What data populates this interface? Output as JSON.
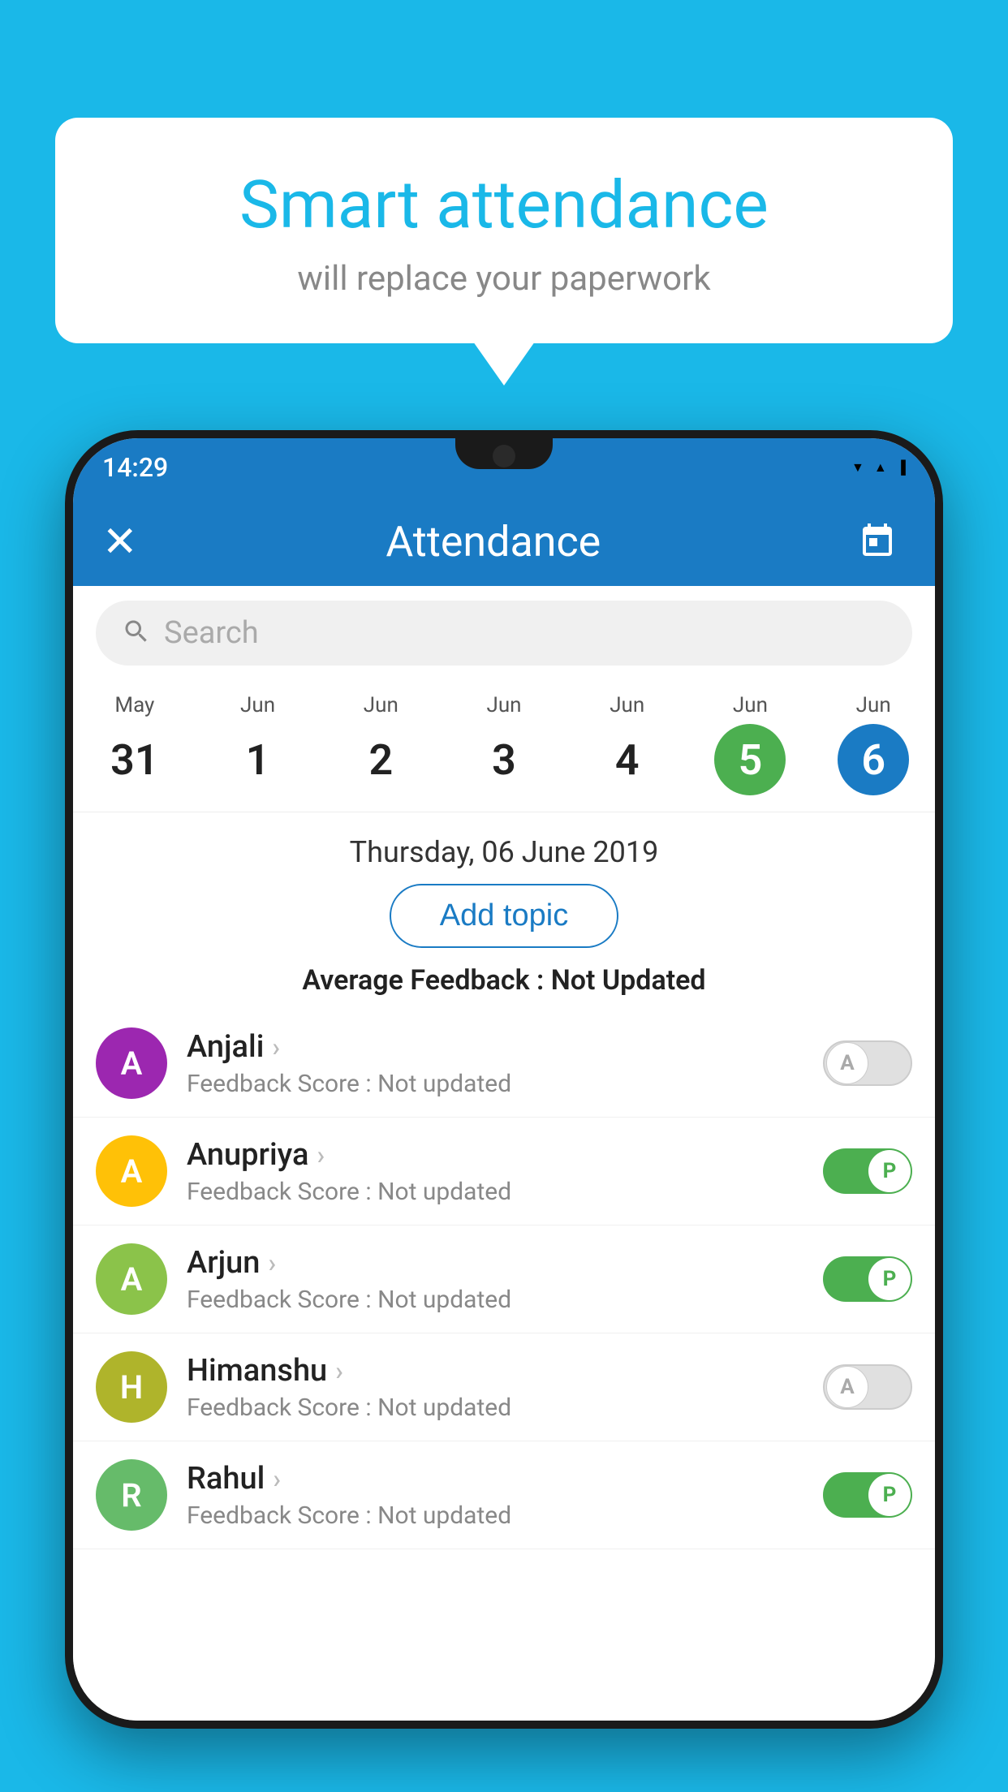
{
  "background_color": "#1ab8e8",
  "bubble": {
    "title": "Smart attendance",
    "subtitle": "will replace your paperwork"
  },
  "status_bar": {
    "time": "14:29",
    "icons": [
      "wifi",
      "signal",
      "battery"
    ]
  },
  "app_bar": {
    "close_label": "×",
    "title": "Attendance",
    "calendar_icon": "📅"
  },
  "search": {
    "placeholder": "Search"
  },
  "calendar": {
    "days": [
      {
        "month": "May",
        "date": "31",
        "style": "normal"
      },
      {
        "month": "Jun",
        "date": "1",
        "style": "normal"
      },
      {
        "month": "Jun",
        "date": "2",
        "style": "normal"
      },
      {
        "month": "Jun",
        "date": "3",
        "style": "normal"
      },
      {
        "month": "Jun",
        "date": "4",
        "style": "normal"
      },
      {
        "month": "Jun",
        "date": "5",
        "style": "today"
      },
      {
        "month": "Jun",
        "date": "6",
        "style": "selected"
      }
    ]
  },
  "selected_date": "Thursday, 06 June 2019",
  "add_topic_label": "Add topic",
  "avg_feedback_label": "Average Feedback :",
  "avg_feedback_value": "Not Updated",
  "students": [
    {
      "name": "Anjali",
      "initial": "A",
      "avatar_color": "purple",
      "feedback_label": "Feedback Score :",
      "feedback_value": "Not updated",
      "status": "absent",
      "toggle_letter": "A"
    },
    {
      "name": "Anupriya",
      "initial": "A",
      "avatar_color": "yellow",
      "feedback_label": "Feedback Score :",
      "feedback_value": "Not updated",
      "status": "present",
      "toggle_letter": "P"
    },
    {
      "name": "Arjun",
      "initial": "A",
      "avatar_color": "light-green",
      "feedback_label": "Feedback Score :",
      "feedback_value": "Not updated",
      "status": "present",
      "toggle_letter": "P"
    },
    {
      "name": "Himanshu",
      "initial": "H",
      "avatar_color": "olive",
      "feedback_label": "Feedback Score :",
      "feedback_value": "Not updated",
      "status": "absent",
      "toggle_letter": "A"
    },
    {
      "name": "Rahul",
      "initial": "R",
      "avatar_color": "green2",
      "feedback_label": "Feedback Score :",
      "feedback_value": "Not updated",
      "status": "present",
      "toggle_letter": "P"
    }
  ]
}
